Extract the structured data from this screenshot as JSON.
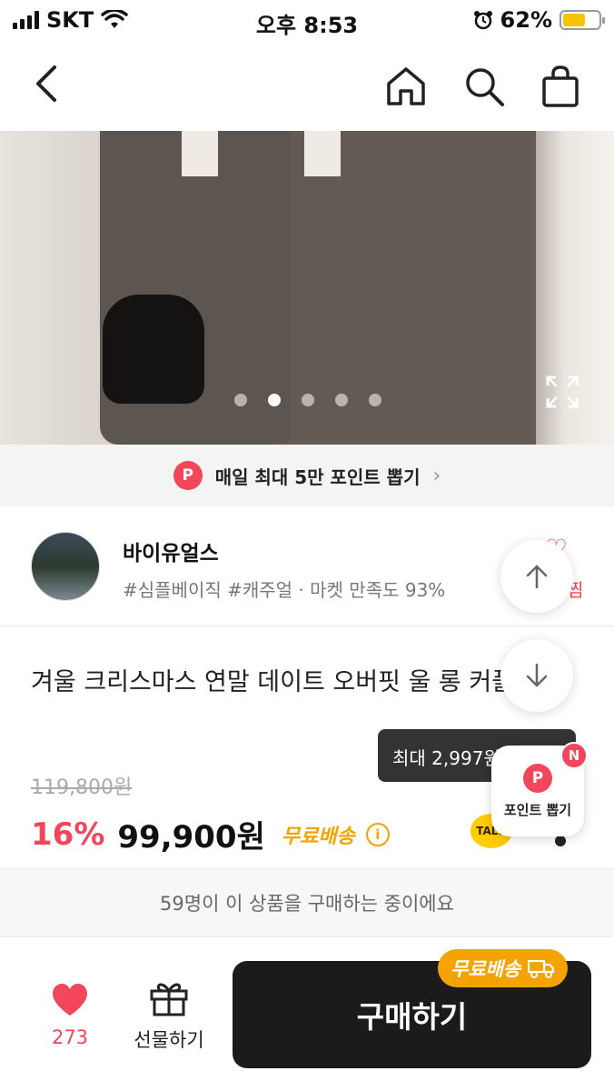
{
  "status_bar": {
    "carrier": "SKT",
    "time": "오후 8:53",
    "battery_percent": "62%",
    "battery_level": 0.62
  },
  "nav": {
    "icons": [
      "back-icon",
      "home-icon",
      "search-icon",
      "shopping-bag-icon"
    ]
  },
  "gallery": {
    "total_images": 5,
    "active_index": 1,
    "icons": [
      "expand-icon"
    ]
  },
  "point_banner": {
    "badge": "P",
    "text": "매일 최대 5만 포인트 뽑기",
    "chevron": "›"
  },
  "seller": {
    "name": "바이유얼스",
    "tags": "#심플베이직 #캐주얼 · 마켓 만족도 93%",
    "follow_glyph": "♡",
    "follow_label_partial": "찜"
  },
  "product": {
    "title": "겨울 크리스마스 연말 데이트 오버핏 울 롱 커플룩",
    "original_price": "119,800원",
    "discount": "16%",
    "price": "99,900원",
    "free_shipping": "무료배송",
    "talk_label": "TALK"
  },
  "point_popup": {
    "tooltip": "최대 2,997원",
    "badge": "P",
    "label": "포인트 뽑기",
    "new_badge": "N"
  },
  "buyers": {
    "text": "59명이 이 상품을 구매하는 중이에요"
  },
  "bottom_bar": {
    "like_count": "273",
    "gift_label": "선물하기",
    "buy_label": "구매하기",
    "free_shipping_pill": "무료배송"
  },
  "colors": {
    "accent": "#f2465a",
    "free_shipping": "#f5a300",
    "buy_button": "#1b1b1b",
    "battery": "#f5c400"
  }
}
